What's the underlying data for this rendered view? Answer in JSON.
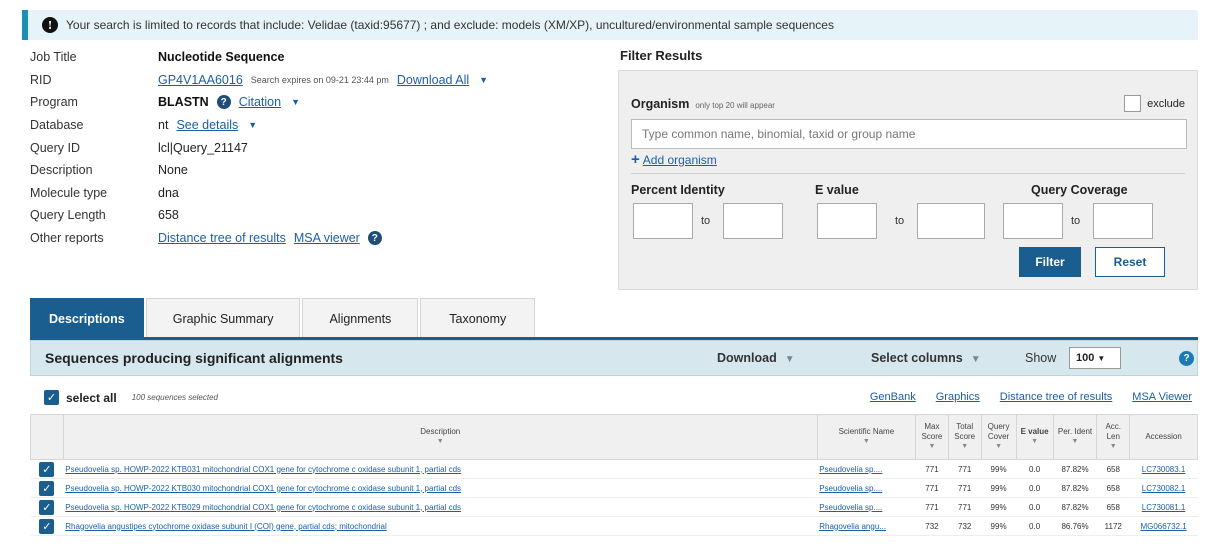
{
  "banner": {
    "text": "Your search is limited to records that include: Velidae (taxid:95677) ; and exclude: models (XM/XP), uncultured/environmental sample sequences"
  },
  "job": {
    "job_title_label": "Job Title",
    "job_title_value": "Nucleotide Sequence",
    "rid_label": "RID",
    "rid_value": "GP4V1AA6016",
    "rid_expiry": "Search expires on 09-21 23:44 pm",
    "download_all": "Download All",
    "program_label": "Program",
    "program_value": "BLASTN",
    "citation": "Citation",
    "database_label": "Database",
    "database_value": "nt",
    "see_details": "See details",
    "query_id_label": "Query ID",
    "query_id_value": "lcl|Query_21147",
    "description_label": "Description",
    "description_value": "None",
    "molecule_label": "Molecule type",
    "molecule_value": "dna",
    "query_length_label": "Query Length",
    "query_length_value": "658",
    "other_reports_label": "Other reports",
    "distance_tree": "Distance tree of results",
    "msa_viewer": "MSA viewer"
  },
  "filter": {
    "title": "Filter Results",
    "organism_label": "Organism",
    "organism_note": "only top 20 will appear",
    "exclude_label": "exclude",
    "organism_placeholder": "Type common name, binomial, taxid or group name",
    "add_organism": "Add organism",
    "percent_identity": "Percent Identity",
    "e_value": "E value",
    "query_coverage": "Query Coverage",
    "to": "to",
    "filter_button": "Filter",
    "reset_button": "Reset"
  },
  "tabs": [
    "Descriptions",
    "Graphic Summary",
    "Alignments",
    "Taxonomy"
  ],
  "results_header": {
    "title": "Sequences producing significant alignments",
    "download": "Download",
    "select_columns": "Select columns",
    "show": "Show",
    "show_value": "100"
  },
  "select_bar": {
    "select_all": "select all",
    "count": "100 sequences selected",
    "links": [
      "GenBank",
      "Graphics",
      "Distance tree of results",
      "MSA Viewer"
    ]
  },
  "table": {
    "headers": {
      "description": "Description",
      "scientific_name": "Scientific Name",
      "max_score": "Max Score",
      "total_score": "Total Score",
      "query_cover": "Query Cover",
      "e_value": "E value",
      "per_ident": "Per. Ident",
      "acc_len": "Acc. Len",
      "accession": "Accession"
    },
    "rows": [
      {
        "description": "Pseudovelia sp. HOWP-2022 KTB031 mitochondrial COX1 gene for cytochrome c oxidase subunit 1, partial cds",
        "sci": "Pseudovelia sp....",
        "max": "771",
        "total": "771",
        "cover": "99%",
        "e": "0.0",
        "ident": "87.82%",
        "len": "658",
        "acc": "LC730083.1"
      },
      {
        "description": "Pseudovelia sp. HOWP-2022 KTB030 mitochondrial COX1 gene for cytochrome c oxidase subunit 1, partial cds",
        "sci": "Pseudovelia sp....",
        "max": "771",
        "total": "771",
        "cover": "99%",
        "e": "0.0",
        "ident": "87.82%",
        "len": "658",
        "acc": "LC730082.1"
      },
      {
        "description": "Pseudovelia sp. HOWP-2022 KTB029 mitochondrial COX1 gene for cytochrome c oxidase subunit 1, partial cds",
        "sci": "Pseudovelia sp....",
        "max": "771",
        "total": "771",
        "cover": "99%",
        "e": "0.0",
        "ident": "87.82%",
        "len": "658",
        "acc": "LC730081.1"
      },
      {
        "description": "Rhagovelia angustipes cytochrome oxidase subunit I (COI) gene, partial cds; mitochondrial",
        "sci": "Rhagovelia angu...",
        "max": "732",
        "total": "732",
        "cover": "99%",
        "e": "0.0",
        "ident": "86.76%",
        "len": "1172",
        "acc": "MG066732.1"
      }
    ]
  }
}
